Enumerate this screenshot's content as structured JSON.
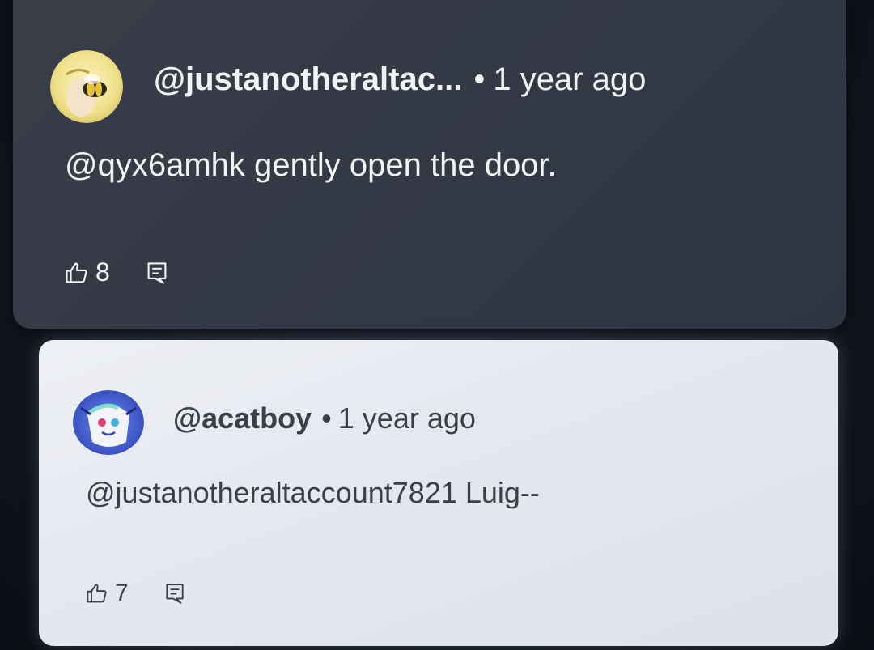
{
  "comments": [
    {
      "handle": "@justanotheraltac...",
      "separator": "•",
      "time": "1 year ago",
      "text": "@qyx6amhk  gently open the door.",
      "likes": "8",
      "avatar_icon": "bee-avatar-icon",
      "theme": "dark"
    },
    {
      "handle": "@acatboy",
      "separator": "•",
      "time": "1 year ago",
      "text": "@justanotheraltaccount7821  Luig--",
      "likes": "7",
      "avatar_icon": "cartoon-cat-avatar-icon",
      "theme": "light"
    }
  ],
  "colors": {
    "dark_card": "#343946",
    "light_card": "#e6e9ef",
    "dark_text": "#f2f3f5",
    "light_text": "#3b3f46"
  }
}
